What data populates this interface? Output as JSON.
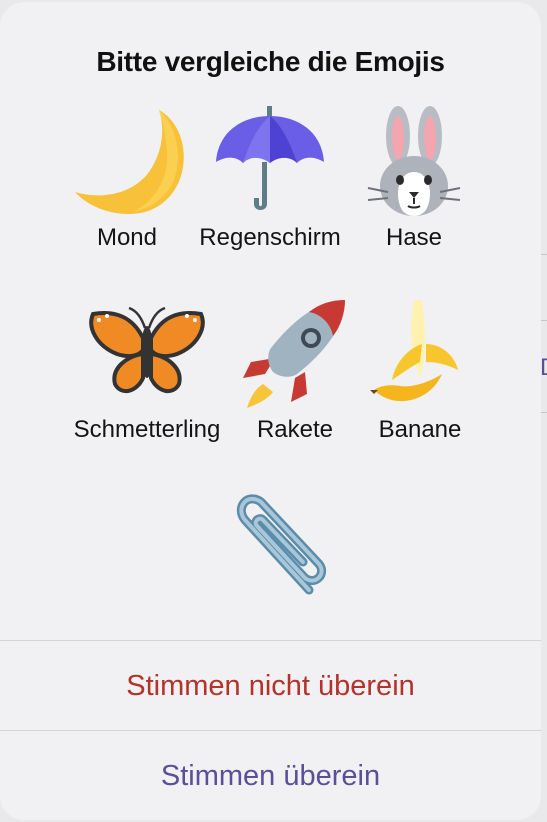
{
  "dialog": {
    "title": "Bitte vergleiche die Emojis"
  },
  "emojis": [
    {
      "icon": "crescent-moon-icon",
      "label": "Mond"
    },
    {
      "icon": "umbrella-icon",
      "label": "Regenschirm"
    },
    {
      "icon": "rabbit-icon",
      "label": "Hase"
    },
    {
      "icon": "butterfly-icon",
      "label": "Schmetterling"
    },
    {
      "icon": "rocket-icon",
      "label": "Rakete"
    },
    {
      "icon": "banana-icon",
      "label": "Banane"
    },
    {
      "icon": "paperclip-icon",
      "label": ""
    }
  ],
  "actions": {
    "mismatch_label": "Stimmen nicht überein",
    "match_label": "Stimmen überein"
  },
  "background": {
    "partial_letter": "D"
  },
  "colors": {
    "mismatch": "#b3322b",
    "match": "#5b4f99"
  }
}
